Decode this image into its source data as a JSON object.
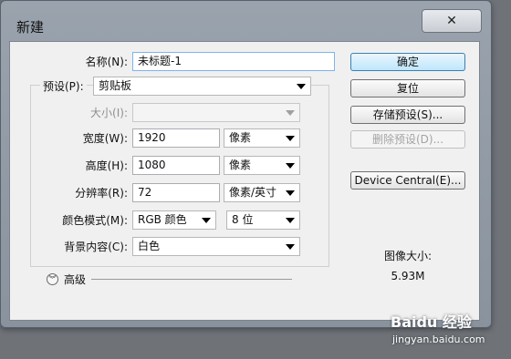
{
  "dialog": {
    "title": "新建",
    "close_glyph": "✕"
  },
  "form": {
    "name": {
      "label": "名称(N):",
      "value": "未标题-1"
    },
    "preset": {
      "label": "预设(P):",
      "value": "剪贴板"
    },
    "size": {
      "label": "大小(I):",
      "value": ""
    },
    "width": {
      "label": "宽度(W):",
      "value": "1920",
      "unit": "像素"
    },
    "height": {
      "label": "高度(H):",
      "value": "1080",
      "unit": "像素"
    },
    "resolution": {
      "label": "分辨率(R):",
      "value": "72",
      "unit": "像素/英寸"
    },
    "color_mode": {
      "label": "颜色模式(M):",
      "value": "RGB 颜色",
      "bits": "8 位"
    },
    "background": {
      "label": "背景内容(C):",
      "value": "白色"
    },
    "advanced": {
      "label": "高级",
      "icon": "chevron-double-down-icon"
    }
  },
  "buttons": {
    "ok": "确定",
    "reset": "复位",
    "save_preset": "存储预设(S)...",
    "delete_preset": "删除预设(D)...",
    "device_central": "Device Central(E)..."
  },
  "image_size": {
    "label": "图像大小:",
    "value": "5.93M"
  },
  "watermark": {
    "brand": "Baidu 经验",
    "url": "jingyan.baidu.com"
  }
}
